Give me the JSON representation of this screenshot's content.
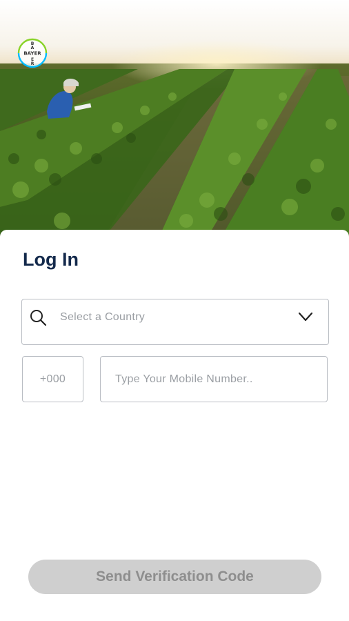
{
  "brand": {
    "logo_name": "bayer-cross-logo",
    "logo_letters": "BAYER",
    "colors": {
      "logo_green": "#89d329",
      "logo_blue": "#00bcff",
      "logo_text": "#333333"
    }
  },
  "login": {
    "title": "Log In",
    "country_select": {
      "placeholder": "Select a Country"
    },
    "country_code": {
      "placeholder": "+000"
    },
    "mobile_number": {
      "placeholder": "Type Your Mobile Number.."
    },
    "send_button": {
      "label": "Send Verification Code",
      "enabled": false
    }
  },
  "theme": {
    "title_color": "#13294b",
    "placeholder_color": "#9a9ea3",
    "border_color": "#b9bdc3",
    "button_disabled_bg": "#cfcfcf",
    "button_disabled_text": "#8e8e8e"
  }
}
